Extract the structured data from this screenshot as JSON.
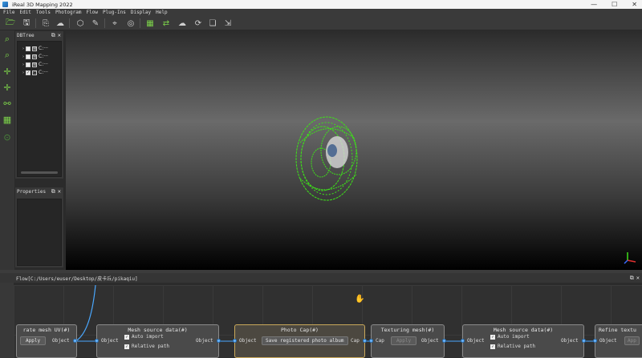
{
  "window": {
    "title": "iReal 3D Mapping 2022",
    "minimize": "—",
    "maximize": "☐",
    "close": "✕"
  },
  "menu": [
    "File",
    "Edit",
    "Tools",
    "Photogram",
    "Flow",
    "Plug-Ins",
    "Display",
    "Help"
  ],
  "dbtree": {
    "title": "DBTree",
    "items": [
      {
        "label": "C:···",
        "checked": false
      },
      {
        "label": "C:···",
        "checked": false
      },
      {
        "label": "C:···",
        "checked": false
      },
      {
        "label": "C:···",
        "checked": true
      }
    ]
  },
  "properties": {
    "title": "Properties"
  },
  "flow": {
    "title": "Flow[C:/Users/euser/Desktop/皮卡丘/pikaqiu]"
  },
  "nodes": {
    "mesh_uv": {
      "title": "rate mesh UV(#)",
      "apply": "Apply",
      "out": "Object"
    },
    "mesh_src1": {
      "title": "Mesh source data(#)",
      "in": "Object",
      "out": "Object",
      "opt1": "Auto import",
      "opt2": "Relative path"
    },
    "photo_cap": {
      "title": "Photo Cap(#)",
      "in": "Object",
      "action": "Save registered photo album",
      "out": "Cap"
    },
    "texturing": {
      "title": "Texturing mesh(#)",
      "in": "Cap",
      "apply": "Apply",
      "out": "Object"
    },
    "mesh_src2": {
      "title": "Mesh source data(#)",
      "in": "Object",
      "out": "Object",
      "opt1": "Auto import",
      "opt2": "Relative path"
    },
    "refine": {
      "title": "Refine textu",
      "in": "Object",
      "apply": "App"
    }
  },
  "colors": {
    "accent_green": "#7cd24a",
    "port_blue": "#6bb6ff",
    "selected_border": "#c9a85a"
  }
}
